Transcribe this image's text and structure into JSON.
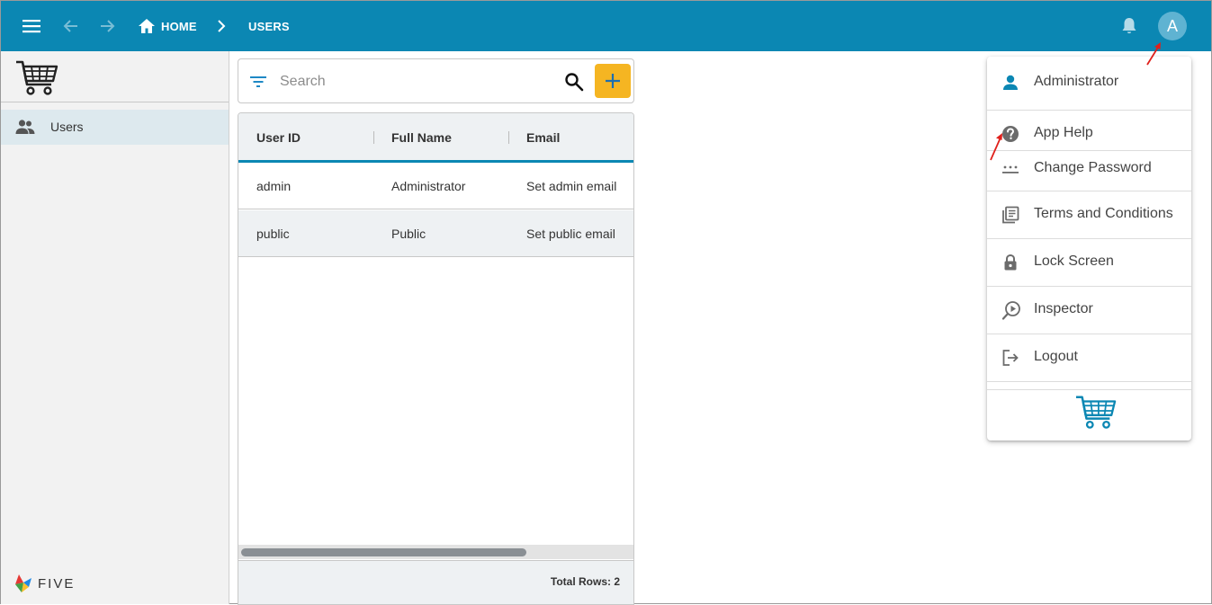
{
  "header": {
    "menu_icon": "hamburger-menu-icon",
    "back_icon": "arrow-back-icon",
    "forward_icon": "arrow-forward-icon",
    "breadcrumb": {
      "home_label": "HOME",
      "current_label": "USERS"
    },
    "avatar_letter": "A",
    "colors": {
      "bar": "#0b87b3",
      "avatar": "#5fb3d2"
    }
  },
  "sidebar": {
    "items": [
      {
        "label": "Users",
        "icon": "users-icon",
        "selected": true
      }
    ],
    "brand": "FIVE"
  },
  "search": {
    "placeholder": "Search",
    "value": ""
  },
  "table": {
    "columns": [
      "User ID",
      "Full Name",
      "Email"
    ],
    "rows": [
      [
        "admin",
        "Administrator",
        "Set admin email"
      ],
      [
        "public",
        "Public",
        "Set public email"
      ]
    ],
    "footer": "Total Rows: 2"
  },
  "user_menu": {
    "items": [
      {
        "label": "Administrator",
        "icon": "person-icon"
      },
      {
        "label": "App Help",
        "icon": "help-circle-icon"
      },
      {
        "label": "Change Password",
        "icon": "password-icon"
      },
      {
        "label": "Terms and Conditions",
        "icon": "document-list-icon"
      },
      {
        "label": "Lock Screen",
        "icon": "lock-icon"
      },
      {
        "label": "Inspector",
        "icon": "inspector-icon"
      },
      {
        "label": "Logout",
        "icon": "logout-icon"
      }
    ]
  },
  "colors": {
    "accent": "#0b87b3",
    "add_button": "#f5b522",
    "annotation": "#e0201b"
  }
}
